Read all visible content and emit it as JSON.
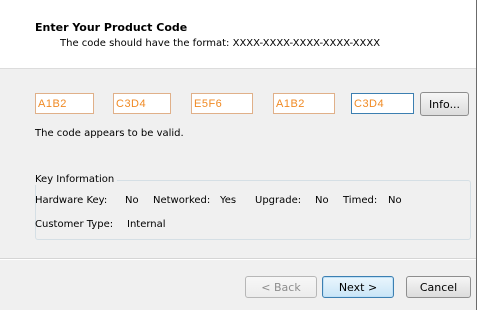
{
  "header": {
    "title": "Enter Your Product Code",
    "subtitle": "The code should have the format: XXXX-XXXX-XXXX-XXXX-XXXX"
  },
  "code_fields": [
    "A1B2",
    "C3D4",
    "E5F6",
    "A1B2",
    "C3D4"
  ],
  "info_button": "Info...",
  "status_text": "The code appears to be valid.",
  "key_info": {
    "legend": "Key Information",
    "hardware_key_label": "Hardware Key:",
    "hardware_key_value": "No",
    "networked_label": "Networked:",
    "networked_value": "Yes",
    "upgrade_label": "Upgrade:",
    "upgrade_value": "No",
    "timed_label": "Timed:",
    "timed_value": "No",
    "customer_type_label": "Customer Type:",
    "customer_type_value": "Internal"
  },
  "footer": {
    "back": "< Back",
    "next": "Next >",
    "cancel": "Cancel"
  },
  "colors": {
    "code_text": "#f08a24",
    "code_border": "#e0b089",
    "focus_border": "#3c7fb1"
  }
}
